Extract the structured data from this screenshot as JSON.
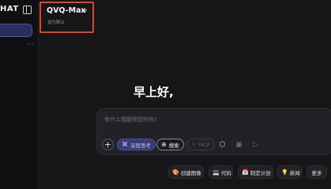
{
  "sidebar": {
    "brand": "HAT",
    "more_icon": "ellipsis-icon",
    "toggle_icon": "sidebar-toggle-icon"
  },
  "model_selector": {
    "name": "QVQ-Max",
    "subtitle": "设为默认"
  },
  "greeting": "早上好,",
  "input": {
    "placeholder": "有什么我能帮您的吗?",
    "tools": {
      "deep_think": "深度思考",
      "search": "搜索",
      "mcp": "MCP"
    }
  },
  "quick_actions": {
    "create_image": "创建图像",
    "code": "代码",
    "plan": "制定计划",
    "news": "新闻",
    "more": "更多"
  },
  "colors": {
    "accent": "#3a3a74",
    "highlight_border": "#d9482a",
    "background": "#161618"
  }
}
